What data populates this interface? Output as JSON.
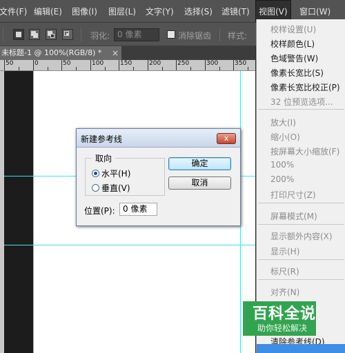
{
  "menubar": {
    "items": [
      {
        "label": "文件(F)"
      },
      {
        "label": "编辑(E)"
      },
      {
        "label": "图像(I)"
      },
      {
        "label": "图层(L)"
      },
      {
        "label": "文字(Y)"
      },
      {
        "label": "选择(S)"
      },
      {
        "label": "滤镜(T)"
      },
      {
        "label": "视图(V)",
        "active": true
      },
      {
        "label": "窗口(W)"
      }
    ]
  },
  "options_bar": {
    "feather_label": "羽化:",
    "feather_value": "0 像素",
    "antialias_label": "消除锯齿",
    "style_label": "样式:"
  },
  "document_tab": {
    "title": "未标题-1 @ 100%(RGB/8) *",
    "close_glyph": "×"
  },
  "ruler": {
    "labels": [
      "50",
      "0",
      "50",
      "100",
      "150",
      "200",
      "250",
      "300",
      "350"
    ]
  },
  "dialog": {
    "title": "新建参考线",
    "close_glyph": "x",
    "orientation_group": "取向",
    "horizontal": "水平(H)",
    "vertical": "垂直(V)",
    "selected_orientation": "水平(H)",
    "ok_button": "确定",
    "cancel_button": "取消",
    "position_label": "位置(P):",
    "position_value": "0 像素"
  },
  "view_menu": {
    "group1": [
      {
        "label": "校样设置(U)",
        "enabled": false
      },
      {
        "label": "校样颜色(L)",
        "enabled": true
      },
      {
        "label": "色域警告(W)",
        "enabled": true
      },
      {
        "label": "像素长宽比(S)",
        "enabled": true
      },
      {
        "label": "像素长宽比校正(P)",
        "enabled": true
      },
      {
        "label": "32 位预览选项...",
        "enabled": false
      }
    ],
    "group2": [
      {
        "label": "放大(I)",
        "enabled": false
      },
      {
        "label": "缩小(O)",
        "enabled": false
      },
      {
        "label": "按屏幕大小缩放(F)",
        "enabled": false
      },
      {
        "label": "100%",
        "enabled": false
      },
      {
        "label": "200%",
        "enabled": false
      },
      {
        "label": "打印尺寸(Z)",
        "enabled": false
      }
    ],
    "group3": [
      {
        "label": "屏幕模式(M)",
        "enabled": false
      }
    ],
    "group4": [
      {
        "label": "显示额外内容(X)",
        "enabled": false
      },
      {
        "label": "显示(H)",
        "enabled": false
      }
    ],
    "group5": [
      {
        "label": "标尺(R)",
        "enabled": false
      }
    ],
    "group6": [
      {
        "label": "对齐(N)",
        "enabled": false
      },
      {
        "label": "清除参考线(D)",
        "enabled": true
      }
    ]
  },
  "watermark": {
    "main": "百科全说",
    "sub": "助你轻松解决"
  },
  "colors": {
    "accent_blue": "#3d8ee4",
    "guide_cyan": "#40e0e8",
    "watermark_green": "#32a44f"
  }
}
